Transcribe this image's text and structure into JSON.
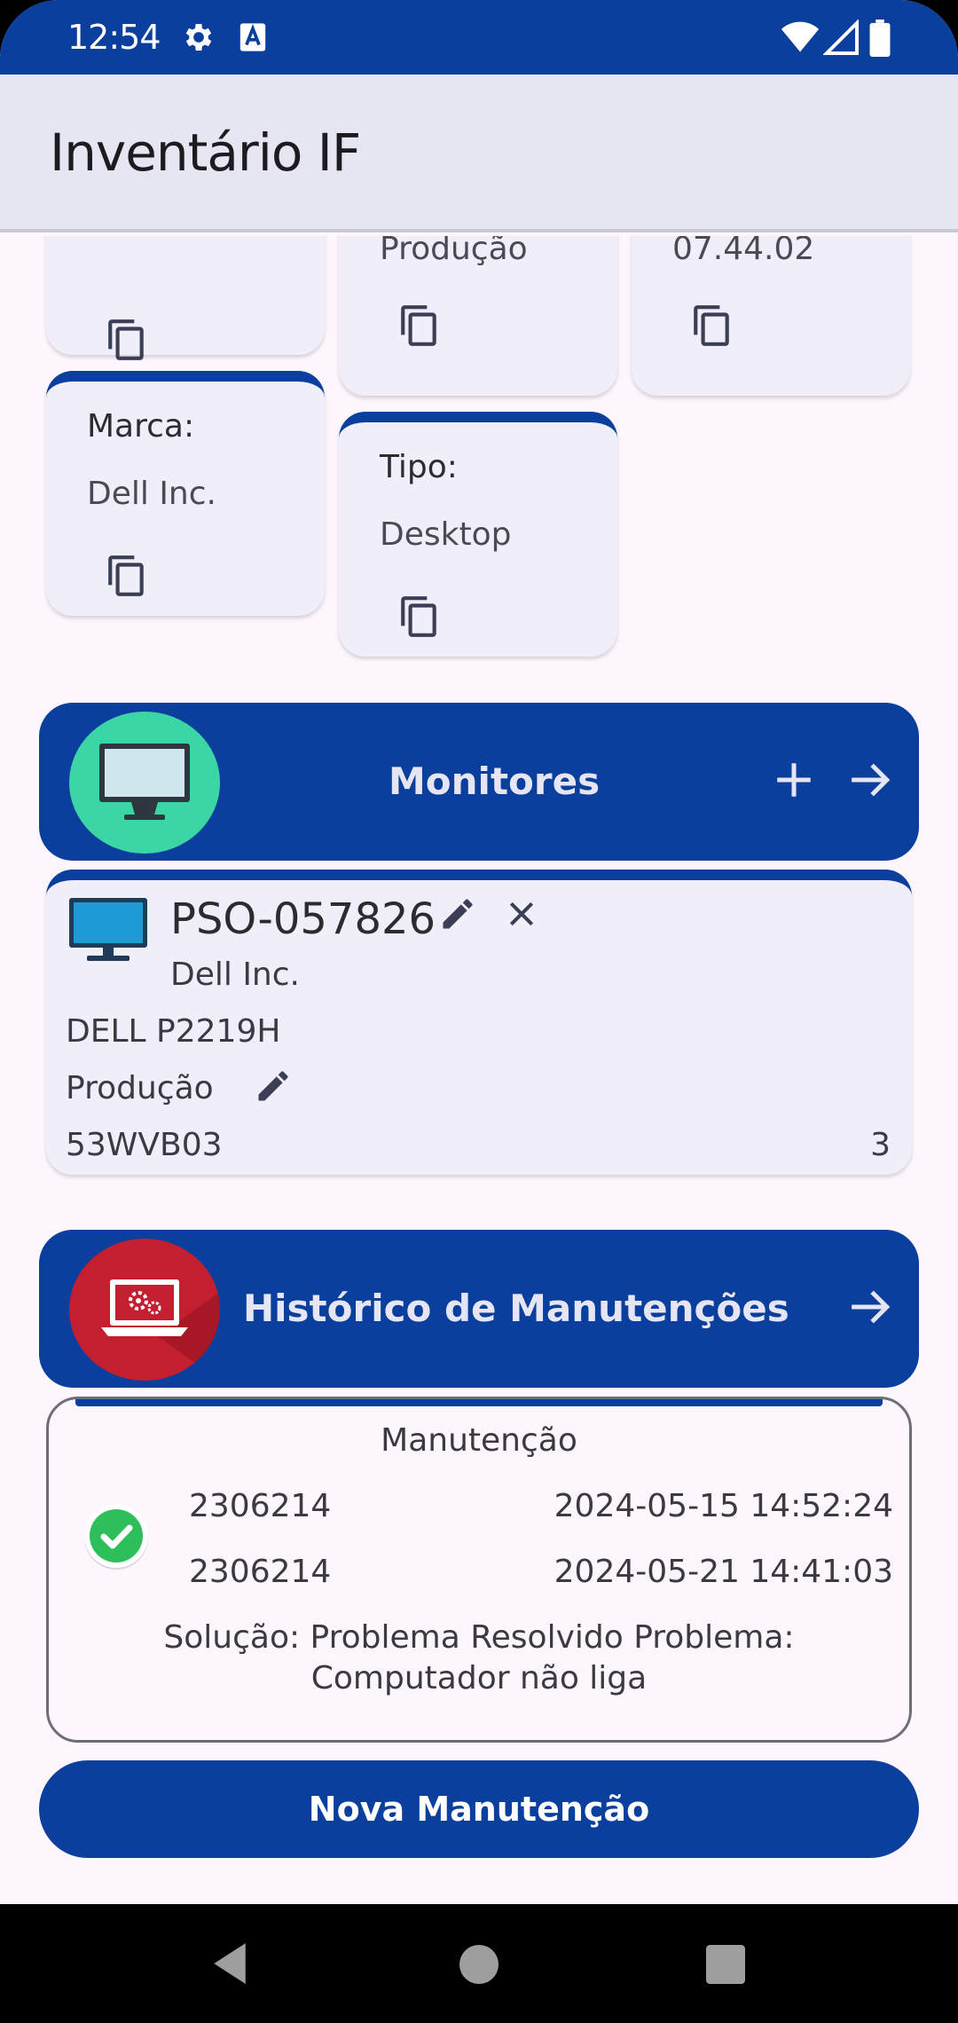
{
  "status_bar": {
    "time": "12:54"
  },
  "app_bar": {
    "title": "Inventário IF"
  },
  "info_cards": [
    {
      "label": "",
      "value": ""
    },
    {
      "label": "",
      "value": "Produção"
    },
    {
      "label": "",
      "value": "07.44.02"
    },
    {
      "label": "Marca:",
      "value": "Dell Inc."
    },
    {
      "label": "Tipo:",
      "value": "Desktop"
    }
  ],
  "monitors_section": {
    "title": "Monitores"
  },
  "monitor_item": {
    "code": "PSO-057826",
    "brand": "Dell Inc.",
    "model": "DELL P2219H",
    "status": "Produção",
    "serial": "53WVB03",
    "count": "3"
  },
  "maintenance_section": {
    "title": "Histórico de Manutenções"
  },
  "maintenance_item": {
    "heading": "Manutenção",
    "id_1": "2306214",
    "date_1": "2024-05-15 14:52:24",
    "id_2": "2306214",
    "date_2": "2024-05-21 14:41:03",
    "description": "Solução: Problema Resolvido Problema: Computador não liga"
  },
  "new_maintenance_button": {
    "label": "Nova Manutenção"
  },
  "colors": {
    "primary": "#0a3f9e",
    "card_bg": "#f0eef8",
    "monitor_circle": "#3ad6a4",
    "maint_circle": "#c41f2e",
    "check_green": "#2fbf5a"
  }
}
